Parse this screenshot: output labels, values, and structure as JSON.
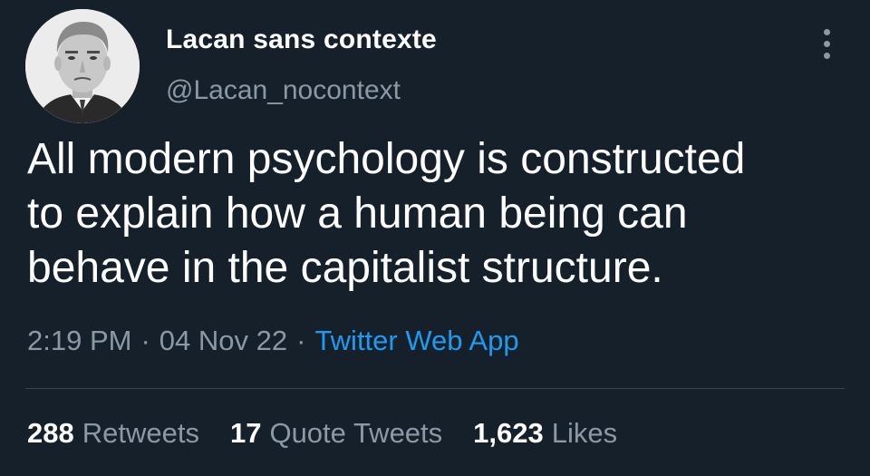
{
  "author": {
    "display_name": "Lacan sans contexte",
    "handle": "@Lacan_nocontext",
    "avatar_icon": "portrait-avatar"
  },
  "tweet": {
    "lines": [
      "All modern psychology is constructed",
      "to explain how a human being can",
      "behave in the capitalist structure."
    ],
    "time": "2:19 PM",
    "date": "04 Nov 22",
    "source": "Twitter Web App",
    "separator": "·"
  },
  "stats": {
    "retweets_count": "288",
    "retweets_label": "Retweets",
    "quotes_count": "17",
    "quotes_label": "Quote Tweets",
    "likes_count": "1,623",
    "likes_label": "Likes"
  },
  "menu": {
    "icon": "more-vertical-icon"
  },
  "colors": {
    "background": "#15202b",
    "primary_text": "#ffffff",
    "secondary_text": "#8b98a5",
    "link": "#1d9bf0",
    "divider": "#38444d"
  }
}
